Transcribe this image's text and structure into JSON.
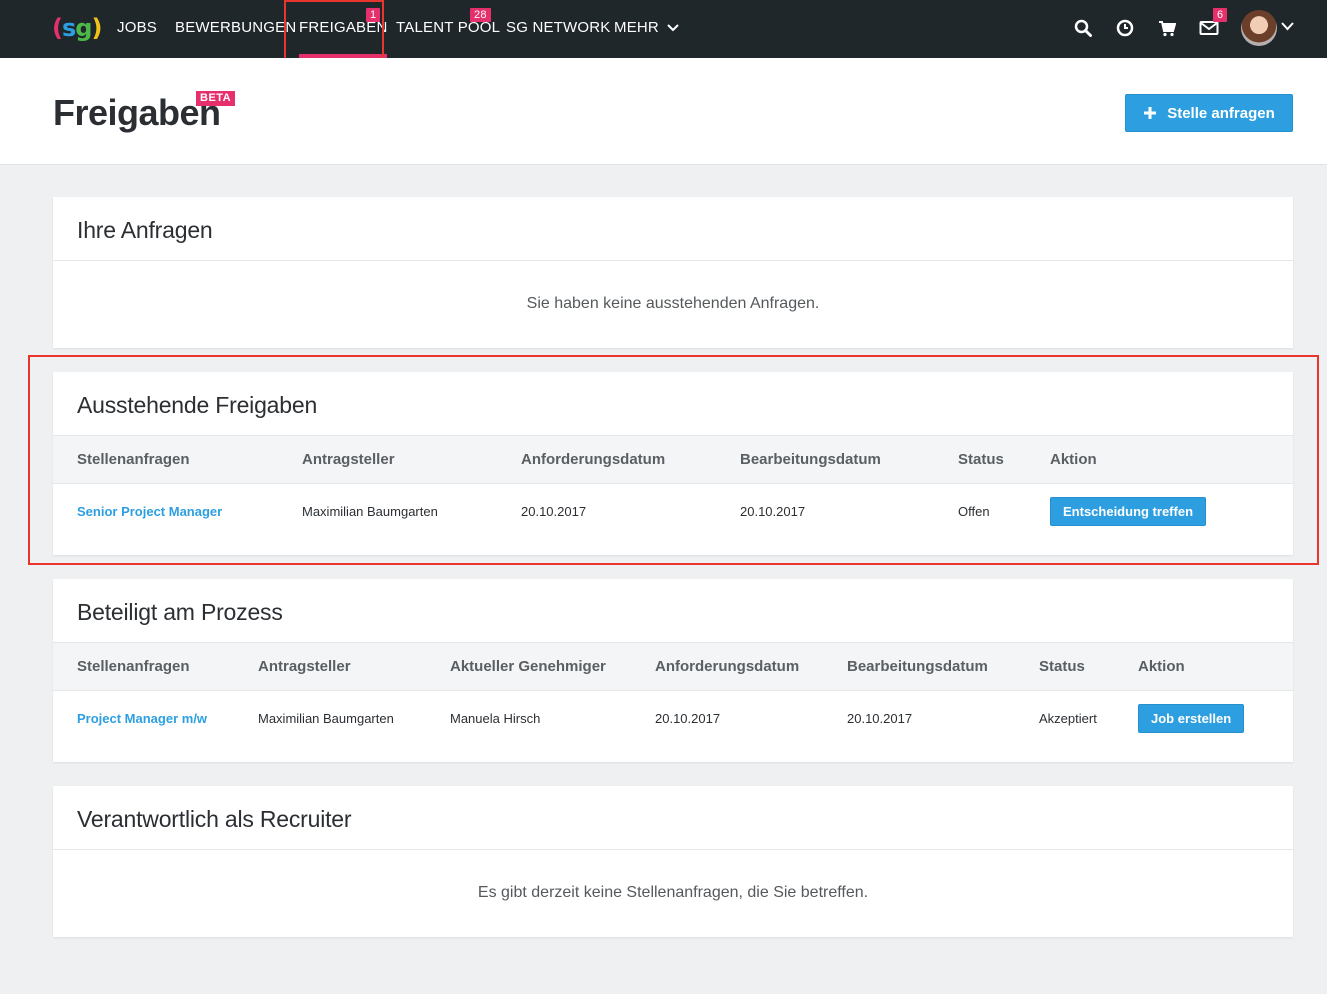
{
  "nav": {
    "logo_text": "(sg)",
    "items": [
      {
        "label": "JOBS"
      },
      {
        "label": "BEWERBUNGEN"
      },
      {
        "label": "FREIGABEN",
        "badge": "1"
      },
      {
        "label": "TALENT POOL",
        "badge": "28"
      },
      {
        "label": "SG NETWORK"
      },
      {
        "label": "MEHR"
      }
    ],
    "icons": [
      "search-icon",
      "clock-icon",
      "cart-icon",
      "mail-icon"
    ],
    "mail_badge": "6",
    "accent_color": "#e5306c"
  },
  "header": {
    "title": "Freigaben",
    "beta": "BETA",
    "request_button": "Stelle anfragen"
  },
  "sections": {
    "ihre_anfragen": {
      "title": "Ihre Anfragen",
      "empty": "Sie haben keine ausstehenden Anfragen."
    },
    "ausstehend": {
      "title": "Ausstehende Freigaben",
      "columns": [
        "Stellenanfragen",
        "Antragsteller",
        "Anforderungsdatum",
        "Bearbeitungsdatum",
        "Status",
        "Aktion"
      ],
      "rows": [
        {
          "job": "Senior Project Manager",
          "applicant": "Maximilian Baumgarten",
          "requested": "20.10.2017",
          "processed": "20.10.2017",
          "status": "Offen",
          "action": "Entscheidung treffen"
        }
      ]
    },
    "beteiligt": {
      "title": "Beteiligt am Prozess",
      "columns": [
        "Stellenanfragen",
        "Antragsteller",
        "Aktueller Genehmiger",
        "Anforderungsdatum",
        "Bearbeitungsdatum",
        "Status",
        "Aktion"
      ],
      "rows": [
        {
          "job": "Project Manager m/w",
          "applicant": "Maximilian Baumgarten",
          "approver": "Manuela Hirsch",
          "requested": "20.10.2017",
          "processed": "20.10.2017",
          "status": "Akzeptiert",
          "action": "Job erstellen"
        }
      ]
    },
    "recruiter": {
      "title": "Verantwortlich als Recruiter",
      "empty": "Es gibt derzeit keine Stellenanfragen, die Sie betreffen."
    }
  },
  "colors": {
    "primary": "#2d9fe0",
    "nav_bg": "#1f272b",
    "highlight": "#e8352d"
  }
}
